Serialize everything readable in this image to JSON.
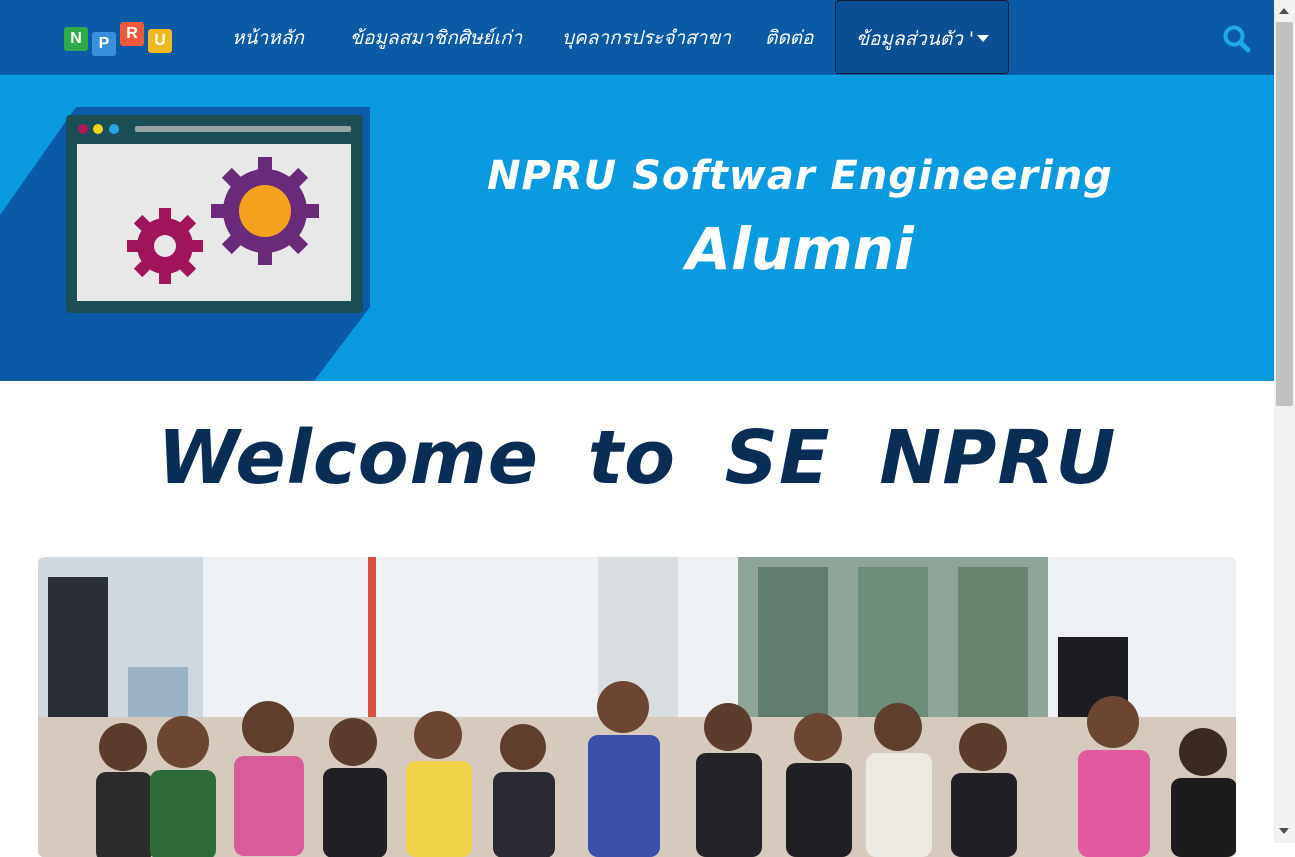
{
  "navbar": {
    "logo_letters": [
      "N",
      "P",
      "R",
      "U"
    ],
    "logo_colors": [
      "#2eaa4a",
      "#3a8fdc",
      "#ef5a3a",
      "#f3b81f"
    ],
    "items": [
      {
        "label": "หน้าหลัก"
      },
      {
        "label": "ข้อมูลสมาชิกศิษย์เก่า"
      },
      {
        "label": "บุคลากรประจำสาขา"
      },
      {
        "label": "ติดต่อ"
      }
    ],
    "active_item": {
      "label": "ข้อมูลส่วนตัว '"
    },
    "search_icon": "search-icon",
    "accent": "#0b5aa6"
  },
  "hero": {
    "title_line1": "NPRU Softwar Engineering",
    "title_line2": "Alumni",
    "background": "#0a9ae0",
    "illustration": "monitor-with-gears"
  },
  "welcome": {
    "heading": "Welcome to SE NPRU",
    "color": "#0a2d55"
  },
  "photo": {
    "subject": "group-photo-students"
  }
}
